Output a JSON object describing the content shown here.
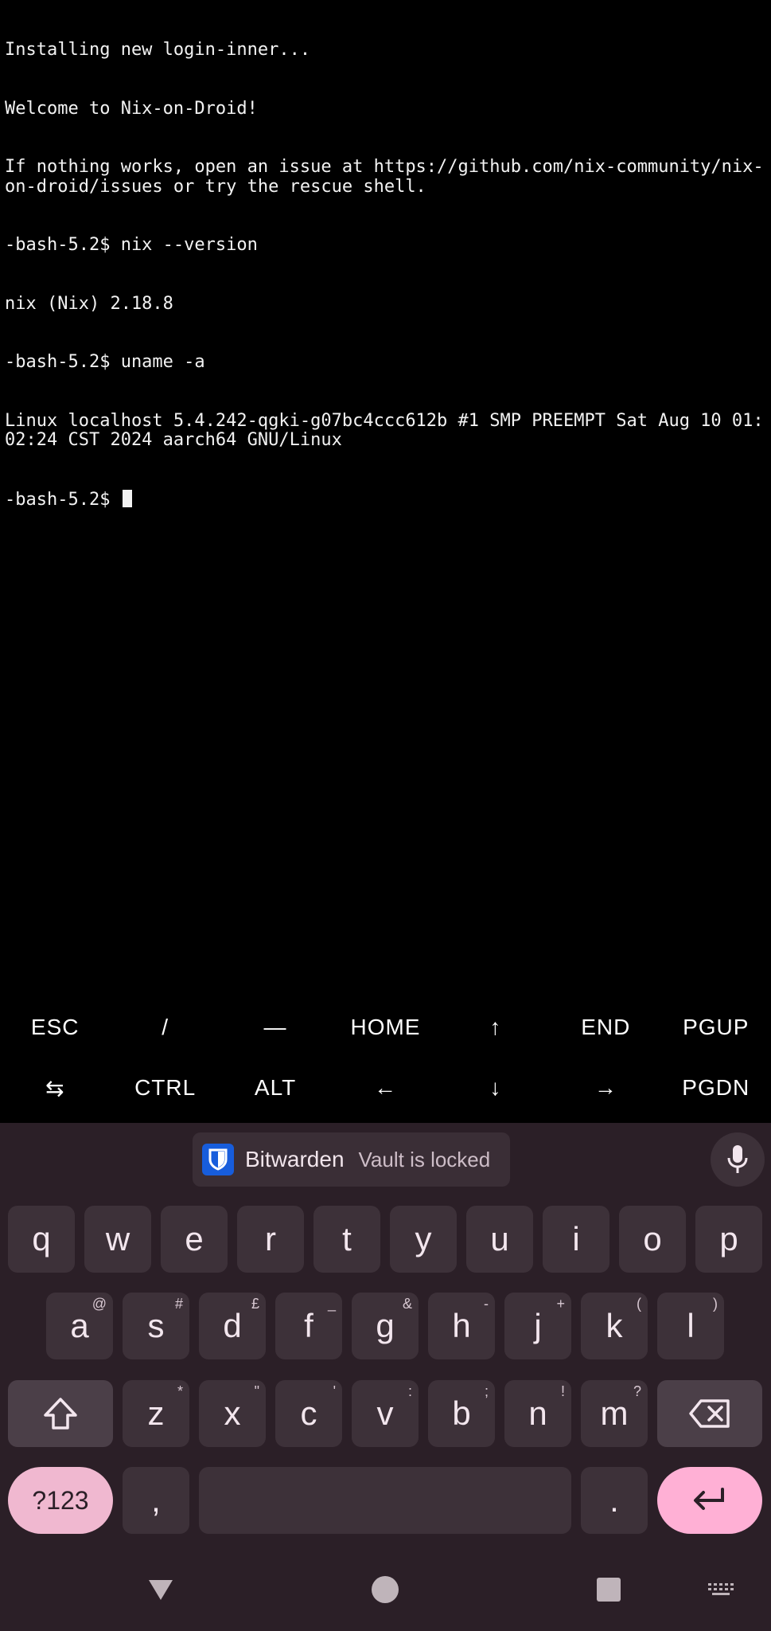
{
  "terminal": {
    "lines": [
      "Installing new login-inner...",
      "Welcome to Nix-on-Droid!",
      "If nothing works, open an issue at https://github.com/nix-community/nix-on-droid/issues or try the rescue shell.",
      "-bash-5.2$ nix --version",
      "nix (Nix) 2.18.8",
      "-bash-5.2$ uname -a",
      "Linux localhost 5.4.242-qgki-g07bc4ccc612b #1 SMP PREEMPT Sat Aug 10 01:02:24 CST 2024 aarch64 GNU/Linux"
    ],
    "prompt": "-bash-5.2$ "
  },
  "extra_keys": {
    "row1": [
      "ESC",
      "/",
      "—",
      "HOME",
      "↑",
      "END",
      "PGUP"
    ],
    "row2": [
      "⇆",
      "CTRL",
      "ALT",
      "←",
      "↓",
      "→",
      "PGDN"
    ]
  },
  "suggestion": {
    "app_name": "Bitwarden",
    "status": "Vault is locked"
  },
  "keyboard": {
    "row1": [
      {
        "key": "q"
      },
      {
        "key": "w"
      },
      {
        "key": "e"
      },
      {
        "key": "r"
      },
      {
        "key": "t"
      },
      {
        "key": "y"
      },
      {
        "key": "u"
      },
      {
        "key": "i"
      },
      {
        "key": "o"
      },
      {
        "key": "p"
      }
    ],
    "row2": [
      {
        "key": "a",
        "hint": "@"
      },
      {
        "key": "s",
        "hint": "#"
      },
      {
        "key": "d",
        "hint": "£"
      },
      {
        "key": "f",
        "hint": "_"
      },
      {
        "key": "g",
        "hint": "&"
      },
      {
        "key": "h",
        "hint": "-"
      },
      {
        "key": "j",
        "hint": "+"
      },
      {
        "key": "k",
        "hint": "("
      },
      {
        "key": "l",
        "hint": ")"
      }
    ],
    "row3": [
      {
        "key": "z",
        "hint": "*"
      },
      {
        "key": "x",
        "hint": "\""
      },
      {
        "key": "c",
        "hint": "'"
      },
      {
        "key": "v",
        "hint": ":"
      },
      {
        "key": "b",
        "hint": ";"
      },
      {
        "key": "n",
        "hint": "!"
      },
      {
        "key": "m",
        "hint": "?"
      }
    ],
    "symbols_label": "?123",
    "comma": ",",
    "period": "."
  },
  "colors": {
    "terminal_bg": "#000000",
    "keyboard_bg": "#2b1f27",
    "key_bg": "#3d3139",
    "accent_pink": "#ffb0d5",
    "bitwarden_blue": "#175ddc"
  }
}
